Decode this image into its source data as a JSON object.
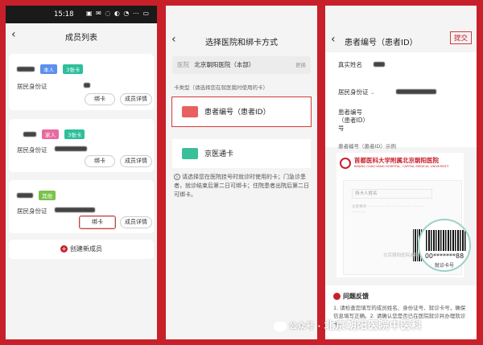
{
  "status_bar": {
    "time": "15:18",
    "icons": "▣ ✉ ◌ ◐ ◔ ⋯ ▭"
  },
  "panel1": {
    "title": "成员列表",
    "members": [
      {
        "tags": [
          "本人",
          "3张卡"
        ],
        "id_label": "居民身份证",
        "bind_label": "绑卡",
        "detail_label": "成员详情"
      },
      {
        "tags": [
          "家人",
          "3张卡"
        ],
        "id_label": "居民身份证",
        "bind_label": "绑卡",
        "detail_label": "成员详情"
      },
      {
        "tags": [
          "其他"
        ],
        "id_label": "居民身份证",
        "bind_label": "绑卡",
        "detail_label": "成员详情"
      }
    ],
    "create_label": "创建新成员"
  },
  "panel2": {
    "title": "选择医院和绑卡方式",
    "hospital_key": "医院",
    "hospital_name": "北京朝阳医院（本部）",
    "switch_label": "更换",
    "card_type_hint": "卡类型（请选择您在就医我时使用的卡）",
    "option_patient_id": "患者编号（患者ID）",
    "option_jingyitong": "京医通卡",
    "note": "请选择您在医院挂号时就诊时使用的卡；门急诊患者，就诊结束后第二日可绑卡；住院患者出院后第二日可绑卡。"
  },
  "panel3": {
    "title": "患者编号（患者ID）",
    "submit_label": "提交",
    "field_name": "真实姓名",
    "field_id": "居民身份证",
    "field_patient_id": "患者编号（患者ID）号",
    "example_label": "患者编号（患者ID）示例",
    "hospital_logo_title": "首都医科大学附属北京朝阳医院",
    "hospital_logo_sub": "BEIJING CHAO-YANG HOSPITAL, CAPITAL MEDICAL UNIVERSITY",
    "sample_field": "持卡人姓名",
    "card_number": "00*******88",
    "card_caption": "就诊卡号",
    "bottom_text": "北京朝阳医院诚挚为广",
    "feedback_title": "问题反馈",
    "feedback_text": "1. 请检查您填写的成员姓名、身份证号、就诊卡号，确保信息填写正确。2. 请确认您是否已在医院就诊并办理就诊卡。"
  },
  "watermark": {
    "prefix": "公众号 ·",
    "text": "北京朝阳医院中医科"
  },
  "colors": {
    "accent": "#c8202a",
    "tag_self": "#5b8ff0",
    "tag_cards": "#2dbf9a",
    "tag_family": "#e86aa0"
  }
}
